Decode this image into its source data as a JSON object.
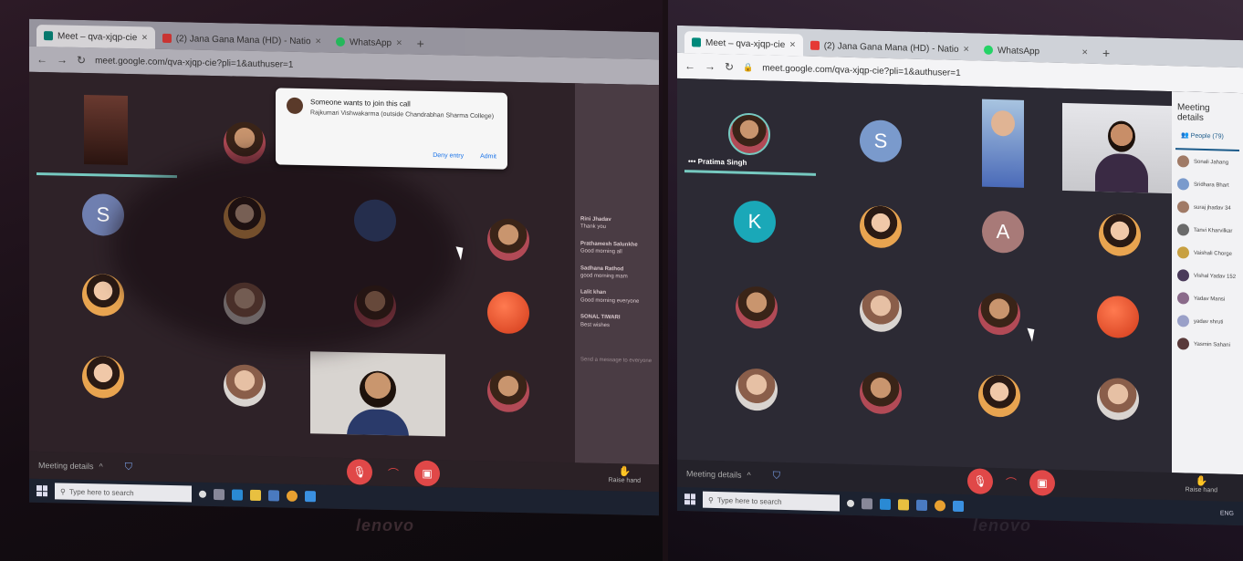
{
  "left_photo": {
    "tabs": [
      {
        "label": "Meet – qva-xjqp-cie",
        "active": true
      },
      {
        "label": "(2) Jana Gana Mana (HD) - Natio",
        "active": false
      },
      {
        "label": "WhatsApp",
        "active": false
      }
    ],
    "url": "meet.google.com/qva-xjqp-cie?pli=1&authuser=1",
    "notification": {
      "title": "Someone wants to join this call",
      "body": "Rajkumari Vishwakarma (outside Chandrabhan Sharma College)",
      "deny": "Deny entry",
      "admit": "Admit"
    },
    "chat": [
      {
        "name": "Rini Jhadav",
        "text": "Thank you"
      },
      {
        "name": "Prathamesh Salunkhe",
        "text": "Good morning all"
      },
      {
        "name": "Sadhana Rathod",
        "text": "good morning mam"
      },
      {
        "name": "Lalit khan",
        "text": "Good morning everyone"
      },
      {
        "name": "SONAL TIWARI",
        "text": "Best wishes"
      }
    ],
    "chat_input_placeholder": "Send a message to everyone",
    "meeting_details": "Meeting details",
    "raise_hand": "Raise hand",
    "search_placeholder": "Type here to search",
    "tile_letter": "S",
    "brand": "lenovo"
  },
  "right_photo": {
    "tabs": [
      {
        "label": "Meet – qva-xjqp-cie",
        "active": true
      },
      {
        "label": "(2) Jana Gana Mana (HD) - Natio",
        "active": false
      },
      {
        "label": "WhatsApp",
        "active": false
      }
    ],
    "url": "meet.google.com/qva-xjqp-cie?pli=1&authuser=1",
    "speaker_name": "Pratima Singh",
    "tile_letters": [
      "S",
      "K",
      "A"
    ],
    "side_panel": {
      "title": "Meeting details",
      "people_tab": "People (79)",
      "people": [
        "Sonali Jahang",
        "Sridhara Bhart",
        "suraj jhadav 34",
        "Tanvi Kharvilkar",
        "Vaishali Chorge",
        "Vishal Yadav 152",
        "Yadav Mansi",
        "yadav shruti",
        "Yasmin Sahani"
      ]
    },
    "meeting_details": "Meeting details",
    "raise_hand": "Raise hand",
    "search_placeholder": "Type here to search",
    "lang": "ENG",
    "brand": "lenovo"
  }
}
